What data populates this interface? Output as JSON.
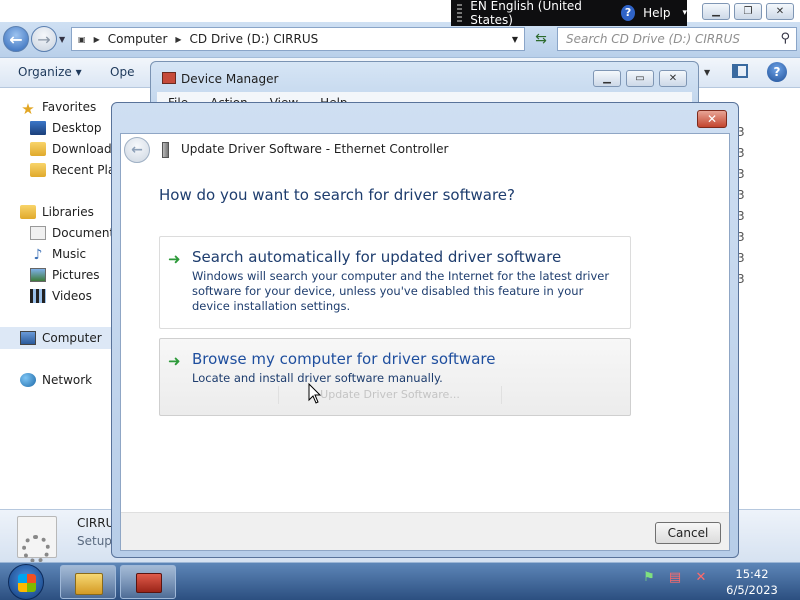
{
  "explorer": {
    "address_parts": [
      "Computer",
      "CD Drive (D:) CIRRUS"
    ],
    "search_placeholder": "Search CD Drive (D:) CIRRUS",
    "toolbar": {
      "organize": "Organize ▾",
      "open": "Ope"
    },
    "sidebar": {
      "favorites": "Favorites",
      "desktop": "Desktop",
      "downloads": "Downloads",
      "recent": "Recent Plac",
      "libraries": "Libraries",
      "documents": "Documents",
      "music": "Music",
      "pictures": "Pictures",
      "videos": "Videos",
      "computer": "Computer",
      "network": "Network"
    },
    "list_trailing": [
      "3",
      "3",
      "3",
      "3",
      "3",
      "3",
      "3",
      "3"
    ],
    "details": {
      "name": "CIRRU",
      "type": "Setup"
    }
  },
  "langbar": {
    "language": "EN English (United States)",
    "help": "Help"
  },
  "device_manager": {
    "title": "Device Manager",
    "menu": [
      "File",
      "Action",
      "View",
      "Help"
    ]
  },
  "wizard": {
    "title": "Update Driver Software - Ethernet Controller",
    "question": "How do you want to search for driver software?",
    "option_auto": {
      "title": "Search automatically for updated driver software",
      "description": "Windows will search your computer and the Internet for the latest driver software for your device, unless you've disabled this feature in your device installation settings."
    },
    "option_browse": {
      "title": "Browse my computer for driver software",
      "description": "Locate and install driver software manually.",
      "ghost": "Update Driver Software..."
    },
    "cancel": "Cancel"
  },
  "taskbar": {
    "time": "15:42",
    "date": "6/5/2023"
  },
  "icons": {
    "start": "windows-start-orb",
    "tray": [
      "action-center-icon",
      "device-icon",
      "speaker-muted-icon"
    ]
  }
}
